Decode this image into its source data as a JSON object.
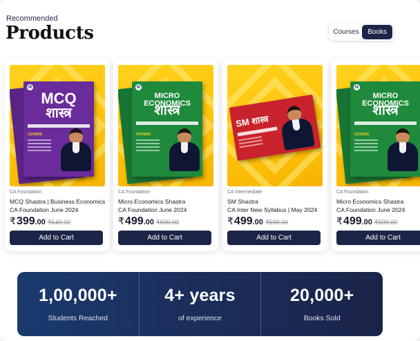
{
  "header": {
    "overline": "Recommended",
    "title": "Products"
  },
  "toggle": {
    "options": [
      "Courses",
      "Books"
    ],
    "selected": "Books"
  },
  "products": [
    {
      "category": "CA Foundation",
      "name_line1": "MCQ Shastra | Business Economics",
      "name_line2": "CA Foundation June 2024",
      "currency": "₹",
      "price": "399",
      "price_decimals": ".00",
      "mrp": "₹549.00",
      "cta": "Add to Cart",
      "book_title_1": "MCQ",
      "book_title_2": "शास्त्र",
      "book_colour": "#6a2c9a"
    },
    {
      "category": "CA Foundation",
      "name_line1": "Micro Economics Shastra",
      "name_line2": "CA Foundation June 2024",
      "currency": "₹",
      "price": "499",
      "price_decimals": ".00",
      "mrp": "₹599.00",
      "cta": "Add to Cart",
      "book_title_1": "MICRO ECONOMICS",
      "book_title_2": "शास्त्र",
      "book_colour": "#1f8a3c"
    },
    {
      "category": "CA Intermediate",
      "name_line1": "SM Shastra",
      "name_line2": "CA Inter New Syllabus | May 2024",
      "currency": "₹",
      "price": "499",
      "price_decimals": ".00",
      "mrp": "₹599.00",
      "cta": "Add to Cart",
      "book_title_1": "SM शास्त्र",
      "book_title_2": "",
      "book_colour": "#c8232c"
    },
    {
      "category": "CA Foundation",
      "name_line1": "Micro Economics Shastra",
      "name_line2": "CA Foundation June 2024",
      "currency": "₹",
      "price": "499",
      "price_decimals": ".00",
      "mrp": "₹599.00",
      "cta": "Add to Cart",
      "book_title_1": "MICRO ECONOMICS",
      "book_title_2": "शास्त्र",
      "book_colour": "#1f8a3c"
    }
  ],
  "stats": [
    {
      "value": "1,00,000+",
      "label": "Students Reached"
    },
    {
      "value": "4+ years",
      "label": "of experience"
    },
    {
      "value": "20,000+",
      "label": "Books Sold"
    }
  ],
  "colors": {
    "primary": "#1c2548",
    "accent_yellow": "#ffc20a"
  }
}
